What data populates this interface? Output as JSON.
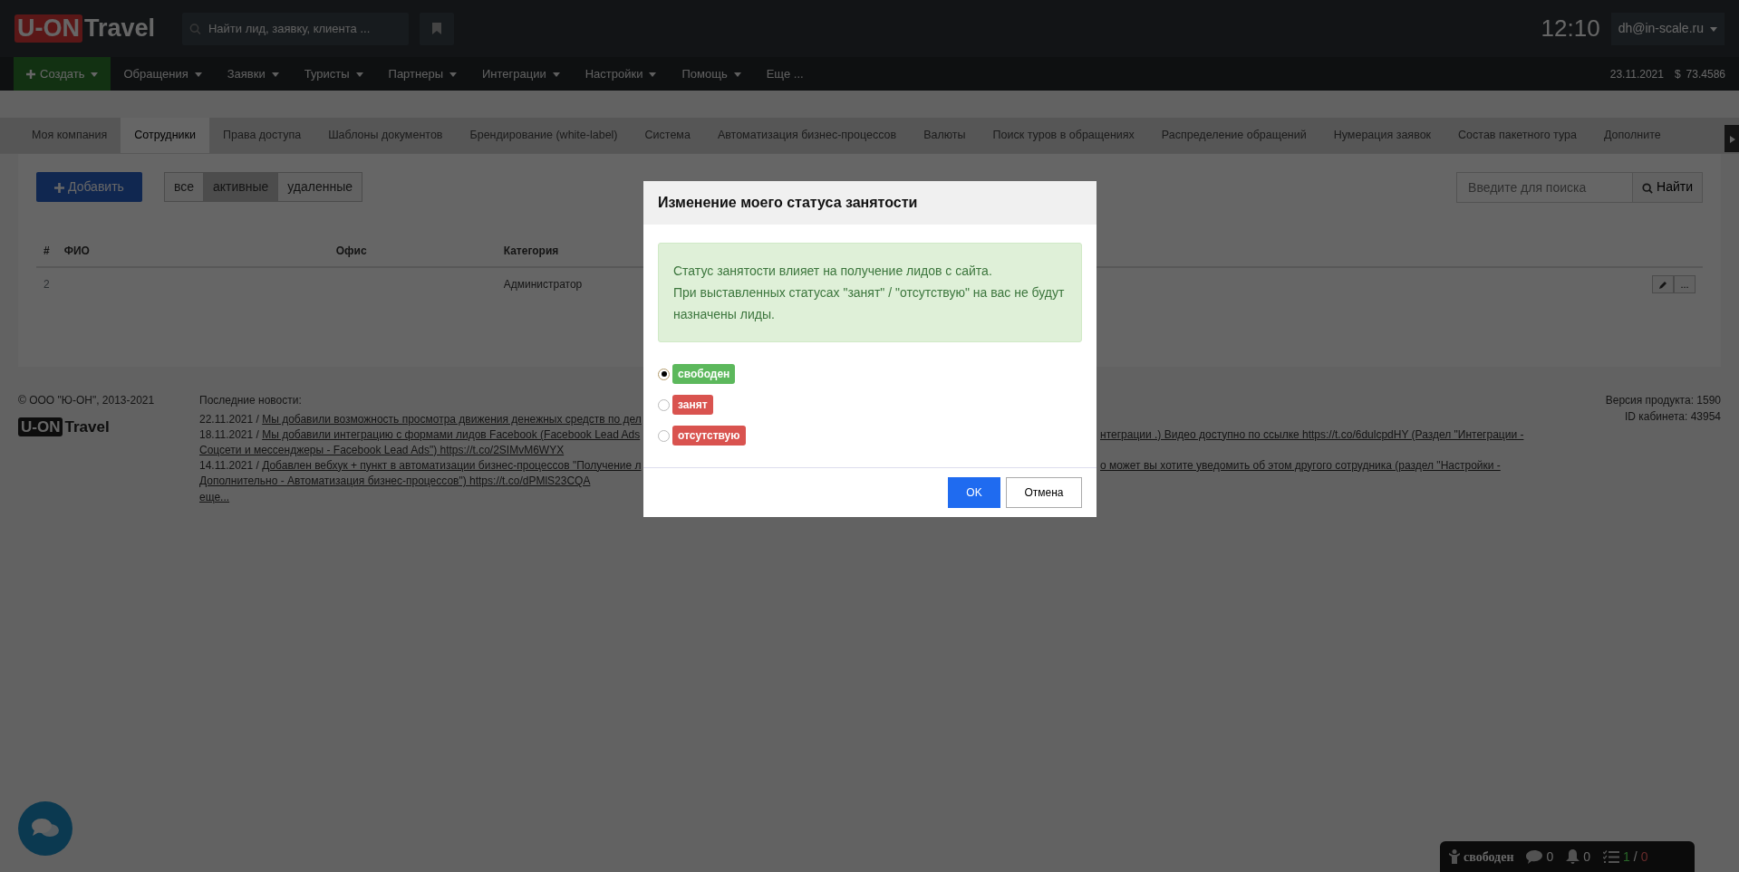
{
  "header": {
    "logo_left": "U-ON",
    "logo_right": "Travel",
    "search": {
      "placeholder": "Найти лид, заявку, клиента ..."
    },
    "time": "12:10",
    "user": "dh@in-scale.ru"
  },
  "nav": {
    "items": [
      {
        "label": "Создать",
        "kind": "create"
      },
      {
        "label": "Обращения",
        "kind": "dropdown"
      },
      {
        "label": "Заявки",
        "kind": "dropdown"
      },
      {
        "label": "Туристы",
        "kind": "dropdown"
      },
      {
        "label": "Партнеры",
        "kind": "dropdown"
      },
      {
        "label": "Интеграции",
        "kind": "dropdown"
      },
      {
        "label": "Настройки",
        "kind": "dropdown"
      },
      {
        "label": "Помощь",
        "kind": "dropdown"
      },
      {
        "label": "Еще ...",
        "kind": "plain"
      }
    ],
    "date": "23.11.2021",
    "currency": "$",
    "rate": "73.4586"
  },
  "tabs": [
    {
      "label": "Моя компания",
      "selected": false
    },
    {
      "label": "Сотрудники",
      "selected": true
    },
    {
      "label": "Права доступа",
      "selected": false
    },
    {
      "label": "Шаблоны документов",
      "selected": false
    },
    {
      "label": "Брендирование (white-label)",
      "selected": false
    },
    {
      "label": "Система",
      "selected": false
    },
    {
      "label": "Автоматизация бизнес-процессов",
      "selected": false
    },
    {
      "label": "Валюты",
      "selected": false
    },
    {
      "label": "Поиск туров в обращениях",
      "selected": false
    },
    {
      "label": "Распределение обращений",
      "selected": false
    },
    {
      "label": "Нумерация заявок",
      "selected": false
    },
    {
      "label": "Состав пакетного тура",
      "selected": false
    },
    {
      "label": "Дополните",
      "selected": false
    }
  ],
  "toolbar": {
    "add": "Добавить",
    "filters": [
      {
        "label": "все",
        "selected": false
      },
      {
        "label": "активные",
        "selected": true
      },
      {
        "label": "удаленные",
        "selected": false
      }
    ],
    "search": {
      "placeholder": "Введите для поиска"
    },
    "search_button": "Найти"
  },
  "table": {
    "columns": [
      "#",
      "ФИО",
      "Офис",
      "Категория"
    ],
    "rows": [
      {
        "number": "2",
        "category": "Администратор",
        "more": "..."
      }
    ]
  },
  "footer": {
    "copyright": "© ООО \"Ю-ОН\", 2013-2021",
    "logo_left": "U-ON",
    "logo_right": "Travel",
    "news_title": "Последние новости:",
    "news": [
      {
        "date": "22.11.2021 /",
        "text": "Мы добавили возможность просмотра движения денежных средств по дел"
      },
      {
        "date": "18.11.2021 /",
        "text": "Мы добавили интеграцию с формами лидов Facebook (Facebook Lead Ads",
        "text_right": "нтеграции .) Видео доступно по ссылке https://t.co/6dulcpdHY (Раздел \"Интеграции -"
      },
      {
        "text": "Соцсети и мессенджеры - Facebook Lead Ads\") https://t.co/2SIMvM6WYX"
      },
      {
        "date": "14.11.2021 /",
        "text": "Добавлен вебхук + пункт в автоматизации бизнес-процессов \"Получение л",
        "text_right": "о может вы хотите уведомить об этом другого сотрудника (раздел \"Настройки -"
      },
      {
        "text": "Дополнительно - Автоматизация бизнес-процессов\") https://t.co/dPMlS23CQA"
      }
    ],
    "more": "еще...",
    "version": "Версия продукта: 1590",
    "cabinet_id": "ID кабинета: 43954"
  },
  "modal": {
    "title": "Изменение моего статуса занятости",
    "info": [
      "Статус занятости влияет на получение лидов с сайта.",
      "При выставленных статусах \"занят\" / \"отсутствую\" на вас не будут назначены лиды."
    ],
    "options": [
      {
        "label": "свободен",
        "selected": true,
        "color": "#5cb85c"
      },
      {
        "label": "занят",
        "selected": false,
        "color": "#d9534f"
      },
      {
        "label": "отсутствую",
        "selected": false,
        "color": "#d9534f"
      }
    ],
    "ok": "OK",
    "cancel": "Отмена"
  },
  "status_bar": {
    "status": "свободен",
    "messages": "0",
    "notifications": "0",
    "tasks_done": "1",
    "tasks_sep": "/",
    "tasks_overdue": "0"
  }
}
